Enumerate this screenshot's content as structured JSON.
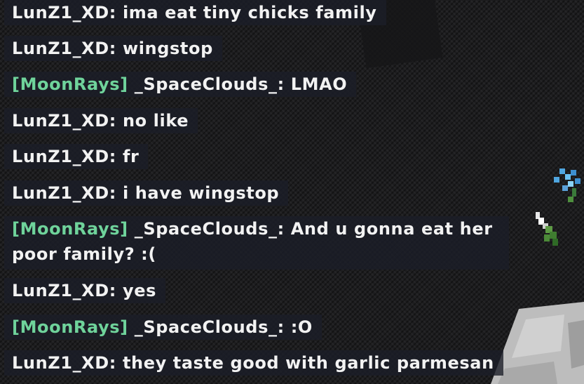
{
  "chat": {
    "messages": [
      {
        "prefix": "",
        "name": "LunZ1_XD",
        "sep": ": ",
        "text": "ima eat tiny chicks family"
      },
      {
        "prefix": "",
        "name": "LunZ1_XD",
        "sep": ": ",
        "text": "wingstop"
      },
      {
        "prefix": "[MoonRays]",
        "name": "_SpaceClouds_",
        "sep": ": ",
        "text": "LMAO"
      },
      {
        "prefix": "",
        "name": "LunZ1_XD",
        "sep": ": ",
        "text": "no like"
      },
      {
        "prefix": "",
        "name": "LunZ1_XD",
        "sep": ": ",
        "text": "fr"
      },
      {
        "prefix": "",
        "name": "LunZ1_XD",
        "sep": ": ",
        "text": "i have wingstop"
      },
      {
        "prefix": "[MoonRays]",
        "name": "_SpaceClouds_",
        "sep": ": ",
        "text": "And u gonna eat her poor family? :("
      },
      {
        "prefix": "",
        "name": "LunZ1_XD",
        "sep": ": ",
        "text": "yes"
      },
      {
        "prefix": "[MoonRays]",
        "name": "_SpaceClouds_",
        "sep": ": ",
        "text": ":O"
      },
      {
        "prefix": "",
        "name": "LunZ1_XD",
        "sep": ": ",
        "text": "they taste good with garlic parmesan"
      }
    ]
  },
  "colors": {
    "rank_prefix": "#6fd39b",
    "chat_text": "#f2f2f2",
    "chat_background": "#1b1e28"
  }
}
